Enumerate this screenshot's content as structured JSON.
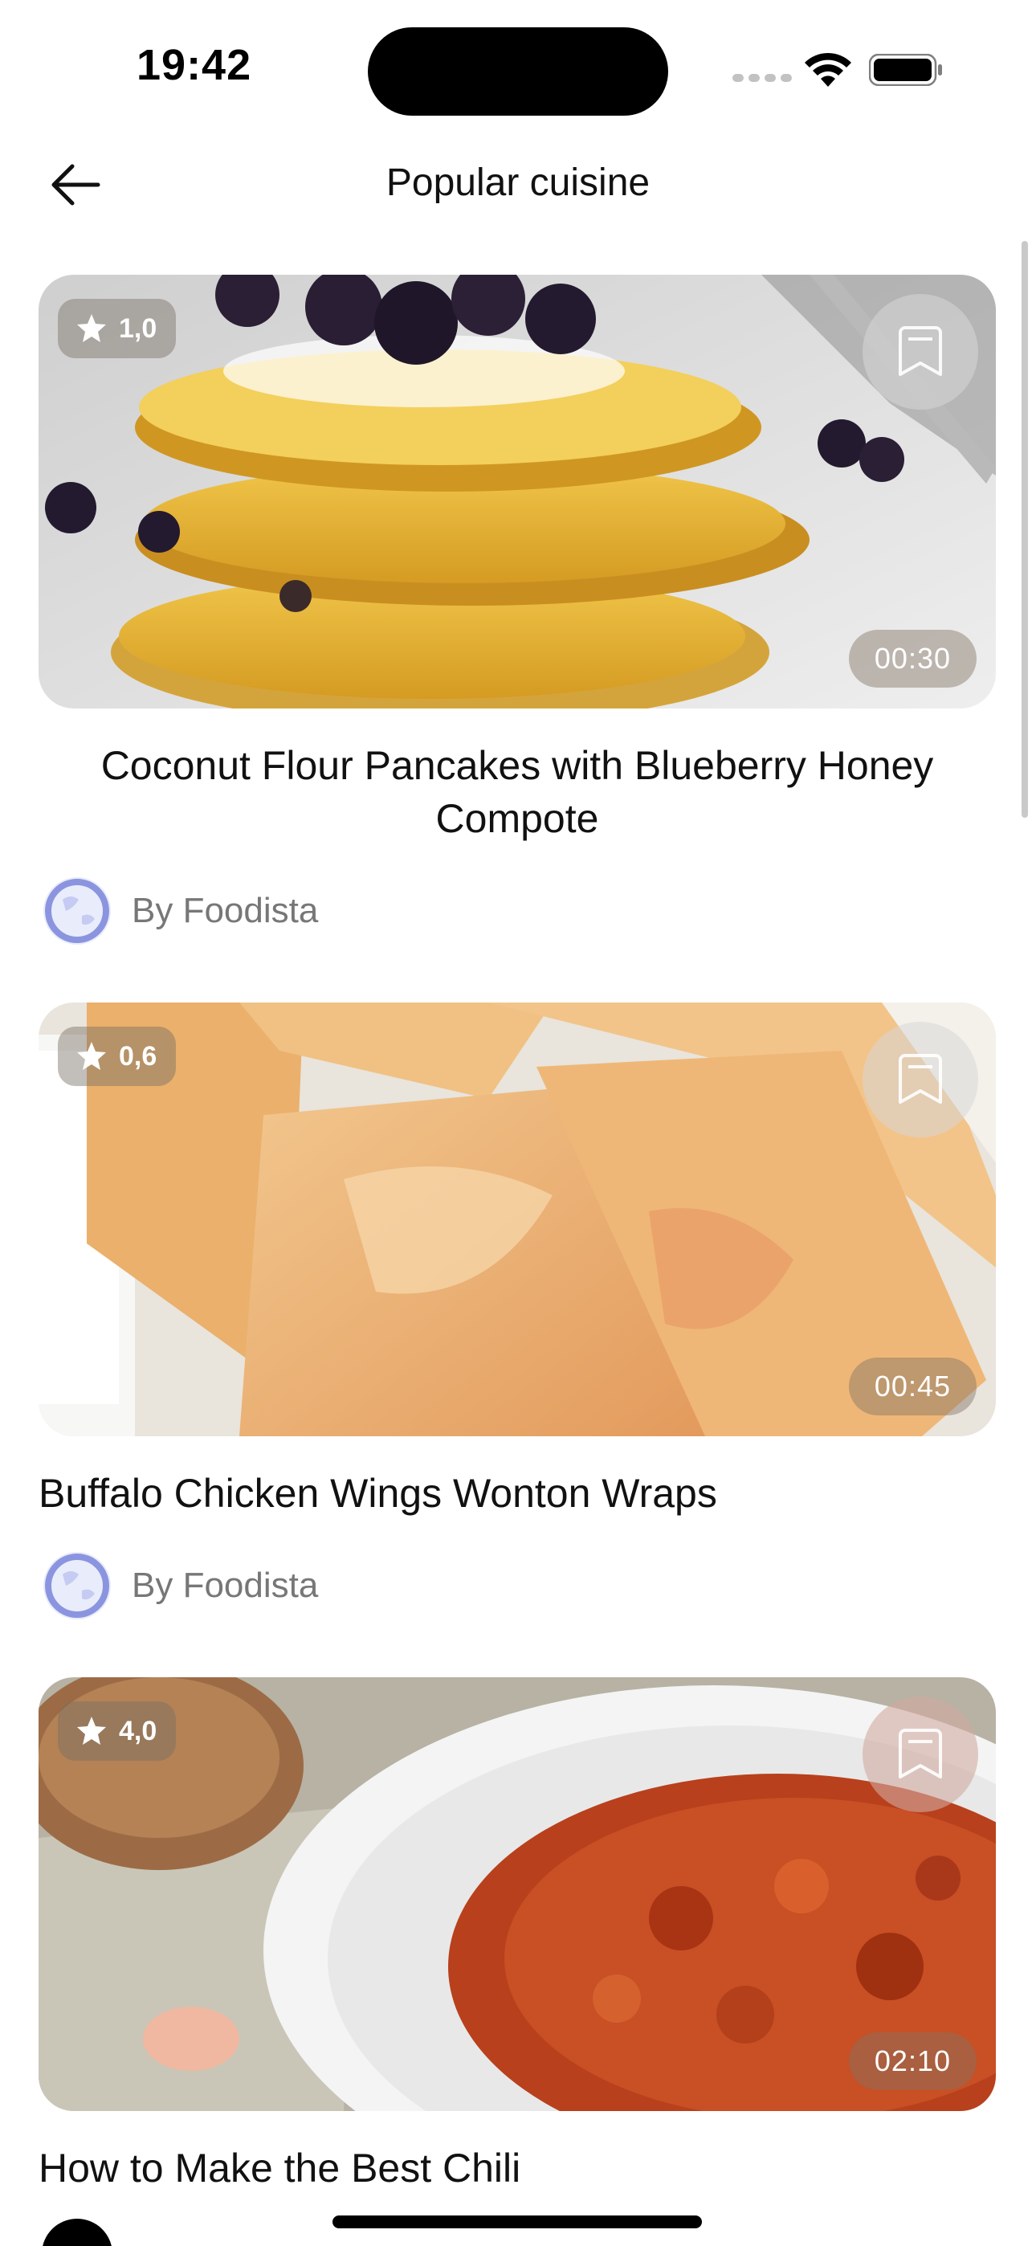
{
  "status_bar": {
    "time": "19:42"
  },
  "header": {
    "title": "Popular cuisine",
    "back_icon": "arrow-left-icon"
  },
  "recipes": [
    {
      "title": "Coconut Flour Pancakes with Blueberry Honey Compote",
      "rating": "1,0",
      "duration": "00:30",
      "author": "By Foodista",
      "avatar": "globe-icon"
    },
    {
      "title": "Buffalo Chicken Wings Wonton Wraps",
      "rating": "0,6",
      "duration": "00:45",
      "author": "By Foodista",
      "avatar": "globe-icon"
    },
    {
      "title": "How to Make the Best Chili",
      "rating": "4,0",
      "duration": "02:10",
      "author": "",
      "avatar": "avatar"
    }
  ],
  "colors": {
    "accent": "#000000",
    "muted_text": "#777777",
    "overlay": "#786e64"
  }
}
